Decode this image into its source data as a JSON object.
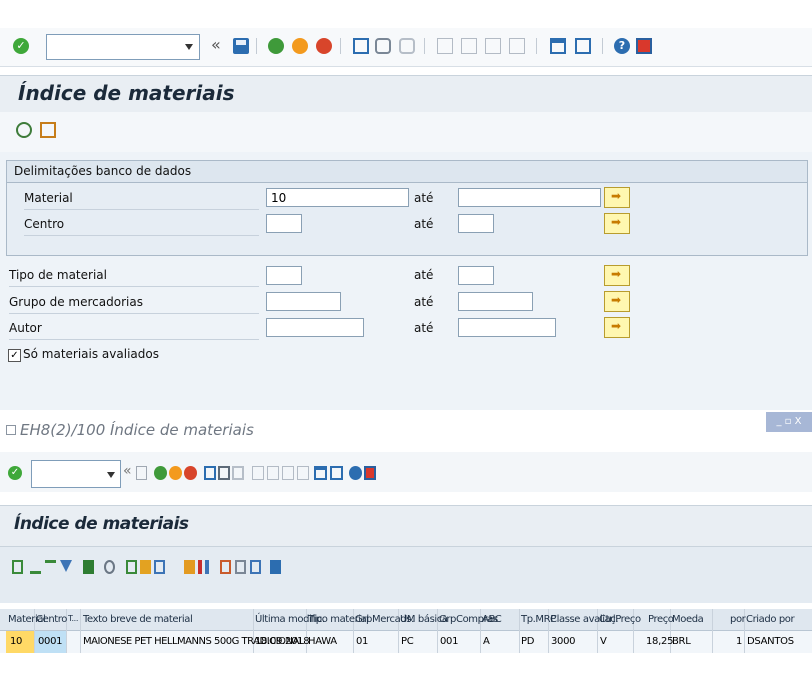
{
  "top_toolbar": {
    "back_symbol": "«"
  },
  "screen1": {
    "title": "Índice de materiais",
    "group_title": "Delimitações banco de dados",
    "fields": [
      {
        "label": "Material",
        "value": "10",
        "to_label": "até",
        "to_value": ""
      },
      {
        "label": "Centro",
        "value": "",
        "to_label": "até",
        "to_value": ""
      },
      {
        "label": "Tipo de material",
        "value": "",
        "to_label": "até",
        "to_value": ""
      },
      {
        "label": "Grupo de mercadorias",
        "value": "",
        "to_label": "até",
        "to_value": ""
      },
      {
        "label": "Autor",
        "value": "",
        "to_label": "até",
        "to_value": ""
      }
    ],
    "checkbox": {
      "label": "Só materiais avaliados",
      "checked": true,
      "mark": "✓"
    }
  },
  "screen2": {
    "window_title": "EH8(2)/100 Índice de materiais",
    "window_controls": "_ ▫ X",
    "back_symbol": "«",
    "title": "Índice de materiais",
    "table": {
      "headers": [
        "Material",
        "Centro",
        "T...",
        "Texto breve de material",
        "Última modific.",
        "Tipo material",
        "GrpMercads.",
        "UM básica",
        "GrpCompras",
        "ABC",
        "Tp.MRP",
        "Classe avaliaç.",
        "CtrlPreço",
        "Preço",
        "Moeda",
        "por",
        "Criado por"
      ],
      "rows": [
        [
          "10",
          "0001",
          "",
          "MAIONESE PET HELLMANNS 500G TRADICIONAL",
          "18.09.2018",
          "HAWA",
          "01",
          "PC",
          "001",
          "A",
          "PD",
          "3000",
          "V",
          "18,25",
          "BRL",
          "1",
          "DSANTOS"
        ]
      ]
    }
  },
  "colors": {
    "accent": "#1b2a3a",
    "input_highlight": "#ffe599",
    "material_cell": "#ffd966",
    "centro_cell": "#bfe0f5"
  }
}
